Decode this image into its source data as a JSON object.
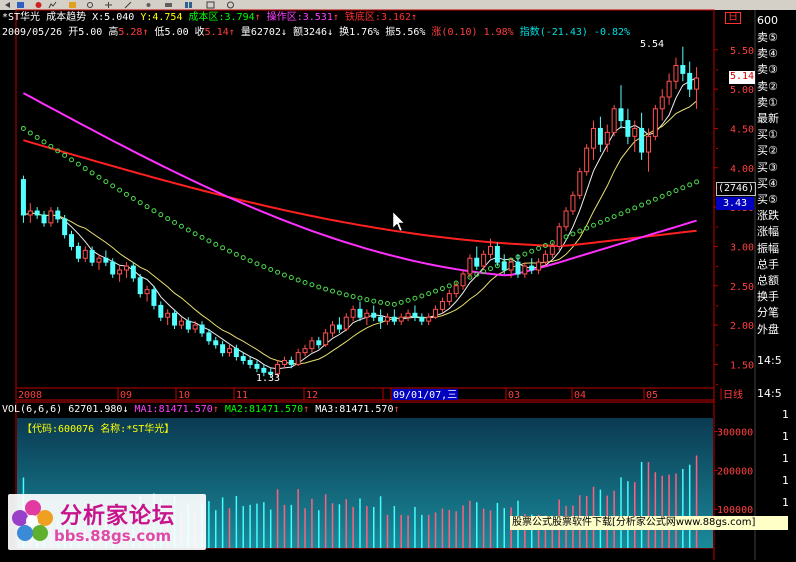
{
  "colors": {
    "background": "#000000",
    "axis_red": "#c00000",
    "up_red": "#ff5050",
    "down_cyan": "#54ffff",
    "ma_white": "#f0f0f0",
    "ma_yellow": "#e8e070",
    "ma_green": "#4cd84c",
    "ma_magenta": "#ff30ff",
    "ma_red": "#ff2020",
    "cyan_text": "#00e0e0",
    "yellow_text": "#ffff00"
  },
  "header": {
    "stock_name": "*ST华光",
    "indicator": "成本趋势",
    "x_label": "X:",
    "x_value": "5.040",
    "y_label": "Y:",
    "y_value": "4.754",
    "cost_label": "成本区:",
    "cost_value": "3.794",
    "op_label": "操作区:",
    "op_value": "3.531",
    "iron_label": "铁底区:",
    "iron_value": "3.162",
    "arrow_up": "↑",
    "arrow_down": "↓"
  },
  "quote": {
    "date": "2009/05/26",
    "open_label": "开",
    "open": "5.00",
    "high_label": "高",
    "high": "5.28",
    "low_label": "低",
    "low": "5.00",
    "close_label": "收",
    "close": "5.14",
    "vol_label": "量",
    "vol": "62702",
    "amount_label": "额",
    "amount": "3246",
    "turnover_label": "换",
    "turnover": "1.76%",
    "amplitude_label": "振",
    "amplitude": "5.56%",
    "change_label": "涨",
    "change": "(0.10)",
    "change_pct": "1.98%",
    "index_label": "指数",
    "index_change": "(-21.43)",
    "index_pct": "-0.82%"
  },
  "chart_labels": {
    "high_mark": "5.54",
    "low_mark": "1.33",
    "price_tag": "5.14",
    "y_tag_code": "(2746)",
    "y_tag_price": "3.43",
    "window_badge": "日"
  },
  "chart_data": {
    "type": "candlestick",
    "title": "*ST华光 成本趋势",
    "ylim": [
      1.2,
      5.65
    ],
    "price_ticks": [
      "5.50",
      "5.00",
      "4.50",
      "4.00",
      "3.50",
      "3.00",
      "2.50",
      "2.00",
      "1.50"
    ],
    "price_tick_values": [
      5.5,
      5.0,
      4.5,
      4.0,
      3.5,
      3.0,
      2.5,
      2.0,
      1.5
    ],
    "x_ticks": [
      "2008",
      "09",
      "10",
      "11",
      "12",
      "2",
      "09/01/07,三",
      "03",
      "04",
      "05",
      "日线"
    ],
    "candles": [
      [
        3.85,
        3.9,
        3.3,
        3.4
      ],
      [
        3.4,
        3.55,
        3.3,
        3.45
      ],
      [
        3.45,
        3.5,
        3.35,
        3.4
      ],
      [
        3.4,
        3.45,
        3.25,
        3.3
      ],
      [
        3.3,
        3.5,
        3.25,
        3.45
      ],
      [
        3.45,
        3.5,
        3.3,
        3.35
      ],
      [
        3.35,
        3.4,
        3.1,
        3.15
      ],
      [
        3.15,
        3.2,
        2.95,
        3.0
      ],
      [
        3.0,
        3.05,
        2.8,
        2.85
      ],
      [
        2.85,
        3.0,
        2.8,
        2.95
      ],
      [
        2.95,
        3.0,
        2.75,
        2.8
      ],
      [
        2.8,
        2.9,
        2.7,
        2.85
      ],
      [
        2.85,
        2.95,
        2.75,
        2.8
      ],
      [
        2.8,
        2.85,
        2.6,
        2.65
      ],
      [
        2.65,
        2.75,
        2.55,
        2.7
      ],
      [
        2.7,
        2.8,
        2.6,
        2.75
      ],
      [
        2.75,
        2.8,
        2.55,
        2.6
      ],
      [
        2.6,
        2.65,
        2.35,
        2.4
      ],
      [
        2.4,
        2.5,
        2.3,
        2.45
      ],
      [
        2.45,
        2.5,
        2.2,
        2.25
      ],
      [
        2.25,
        2.3,
        2.05,
        2.1
      ],
      [
        2.1,
        2.2,
        2.0,
        2.15
      ],
      [
        2.15,
        2.2,
        1.95,
        2.0
      ],
      [
        2.0,
        2.1,
        1.95,
        2.05
      ],
      [
        2.05,
        2.1,
        1.9,
        1.95
      ],
      [
        1.95,
        2.05,
        1.9,
        2.0
      ],
      [
        2.0,
        2.05,
        1.85,
        1.9
      ],
      [
        1.9,
        1.95,
        1.75,
        1.8
      ],
      [
        1.8,
        1.85,
        1.7,
        1.75
      ],
      [
        1.75,
        1.8,
        1.6,
        1.65
      ],
      [
        1.65,
        1.75,
        1.6,
        1.7
      ],
      [
        1.7,
        1.75,
        1.55,
        1.6
      ],
      [
        1.6,
        1.65,
        1.5,
        1.55
      ],
      [
        1.55,
        1.6,
        1.45,
        1.5
      ],
      [
        1.5,
        1.55,
        1.4,
        1.45
      ],
      [
        1.45,
        1.5,
        1.35,
        1.4
      ],
      [
        1.4,
        1.45,
        1.33,
        1.38
      ],
      [
        1.38,
        1.55,
        1.35,
        1.5
      ],
      [
        1.5,
        1.6,
        1.45,
        1.55
      ],
      [
        1.55,
        1.6,
        1.45,
        1.5
      ],
      [
        1.5,
        1.7,
        1.48,
        1.65
      ],
      [
        1.65,
        1.75,
        1.6,
        1.7
      ],
      [
        1.7,
        1.85,
        1.65,
        1.8
      ],
      [
        1.8,
        1.85,
        1.7,
        1.75
      ],
      [
        1.75,
        1.95,
        1.72,
        1.9
      ],
      [
        1.9,
        2.05,
        1.85,
        2.0
      ],
      [
        2.0,
        2.1,
        1.9,
        1.95
      ],
      [
        1.95,
        2.15,
        1.92,
        2.1
      ],
      [
        2.1,
        2.25,
        2.05,
        2.2
      ],
      [
        2.2,
        2.3,
        2.05,
        2.1
      ],
      [
        2.1,
        2.2,
        2.0,
        2.15
      ],
      [
        2.15,
        2.25,
        2.05,
        2.1
      ],
      [
        2.1,
        2.2,
        1.95,
        2.05
      ],
      [
        2.05,
        2.15,
        2.0,
        2.1
      ],
      [
        2.1,
        2.2,
        2.0,
        2.05
      ],
      [
        2.05,
        2.15,
        2.0,
        2.1
      ],
      [
        2.1,
        2.2,
        2.05,
        2.15
      ],
      [
        2.15,
        2.25,
        2.05,
        2.1
      ],
      [
        2.1,
        2.15,
        2.0,
        2.05
      ],
      [
        2.05,
        2.15,
        2.0,
        2.1
      ],
      [
        2.1,
        2.25,
        2.08,
        2.2
      ],
      [
        2.2,
        2.35,
        2.15,
        2.3
      ],
      [
        2.3,
        2.45,
        2.25,
        2.4
      ],
      [
        2.4,
        2.55,
        2.35,
        2.5
      ],
      [
        2.5,
        2.7,
        2.45,
        2.65
      ],
      [
        2.65,
        2.9,
        2.6,
        2.85
      ],
      [
        2.85,
        3.0,
        2.7,
        2.75
      ],
      [
        2.75,
        2.95,
        2.7,
        2.9
      ],
      [
        2.9,
        3.1,
        2.85,
        3.0
      ],
      [
        3.0,
        3.05,
        2.75,
        2.8
      ],
      [
        2.8,
        2.9,
        2.65,
        2.7
      ],
      [
        2.7,
        2.85,
        2.6,
        2.8
      ],
      [
        2.8,
        2.9,
        2.6,
        2.65
      ],
      [
        2.65,
        2.8,
        2.6,
        2.75
      ],
      [
        2.75,
        2.85,
        2.65,
        2.7
      ],
      [
        2.7,
        2.85,
        2.65,
        2.8
      ],
      [
        2.8,
        2.95,
        2.75,
        2.9
      ],
      [
        2.9,
        3.05,
        2.85,
        3.0
      ],
      [
        3.0,
        3.3,
        2.95,
        3.25
      ],
      [
        3.25,
        3.5,
        3.2,
        3.45
      ],
      [
        3.45,
        3.7,
        3.4,
        3.65
      ],
      [
        3.65,
        4.0,
        3.6,
        3.95
      ],
      [
        3.95,
        4.3,
        3.9,
        4.25
      ],
      [
        4.25,
        4.6,
        4.1,
        4.5
      ],
      [
        4.5,
        4.65,
        4.2,
        4.3
      ],
      [
        4.3,
        4.55,
        4.2,
        4.45
      ],
      [
        4.45,
        4.8,
        4.4,
        4.75
      ],
      [
        4.75,
        5.05,
        4.5,
        4.6
      ],
      [
        4.6,
        4.75,
        4.3,
        4.4
      ],
      [
        4.4,
        4.6,
        4.2,
        4.5
      ],
      [
        4.5,
        4.7,
        4.1,
        4.2
      ],
      [
        4.2,
        4.5,
        3.95,
        4.4
      ],
      [
        4.4,
        4.8,
        4.35,
        4.75
      ],
      [
        4.75,
        5.0,
        4.6,
        4.9
      ],
      [
        4.9,
        5.2,
        4.8,
        5.1
      ],
      [
        5.1,
        5.4,
        5.0,
        5.3
      ],
      [
        5.3,
        5.54,
        5.1,
        5.2
      ],
      [
        5.2,
        5.35,
        4.9,
        5.0
      ],
      [
        5.0,
        5.28,
        4.75,
        5.14
      ]
    ],
    "volume_ticks": [
      "300000",
      "200000",
      "100000"
    ],
    "volume_tick_values": [
      300000,
      200000,
      100000
    ],
    "volume_ylim": [
      0,
      335000
    ]
  },
  "volume_header": {
    "name": "VOL(6,6,6)",
    "vol_value": "62701.980",
    "ma1_label": "MA1:",
    "ma1_value": "81471.570",
    "ma2_label": "MA2:",
    "ma2_value": "81471.570",
    "ma3_label": "MA3:",
    "ma3_value": "81471.570"
  },
  "code_line": {
    "open_bracket": "【",
    "code_label": "代码:",
    "code": "600076",
    "name_label": "名称:",
    "name": "*ST华光",
    "close_bracket": "】"
  },
  "right_panel": {
    "top_value": "600",
    "items": [
      "卖⑤",
      "卖④",
      "卖③",
      "卖②",
      "卖①",
      "最新",
      "买①",
      "买②",
      "买③",
      "买④",
      "买⑤",
      "涨跌",
      "涨幅",
      "振幅",
      "总手",
      "总额",
      "换手",
      "分笔",
      "外盘"
    ],
    "time1": "14:5",
    "time2": "14:5",
    "tail_values": [
      "1",
      "1",
      "1",
      "1",
      "1"
    ]
  },
  "banner": {
    "text": "股票公式股票软件下载[分析家公式网www.88gs.com]"
  },
  "logo": {
    "name": "分析家论坛",
    "url": "bbs.88gs.com"
  }
}
